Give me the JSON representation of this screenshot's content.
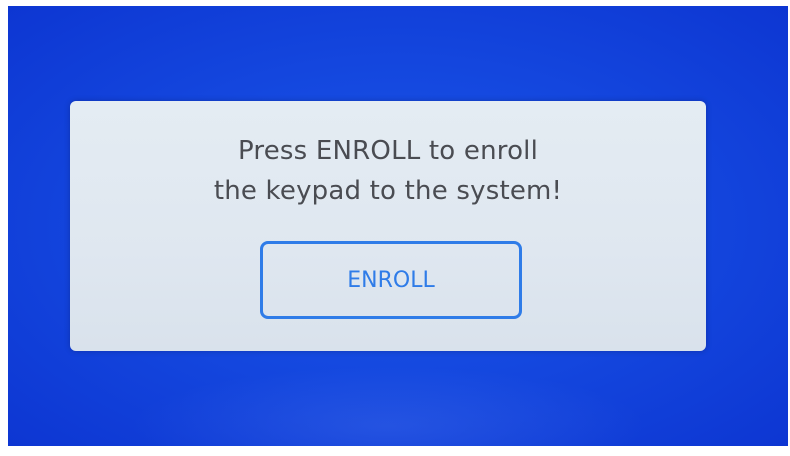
{
  "dialog": {
    "message_line1": "Press ENROLL to enroll",
    "message_line2": "the keypad to the system!",
    "enroll_label": "ENROLL"
  },
  "colors": {
    "screen_background": "#1549e0",
    "dialog_background": "#e0e8f1",
    "text": "#4a4c52",
    "accent": "#2f7ce8"
  }
}
